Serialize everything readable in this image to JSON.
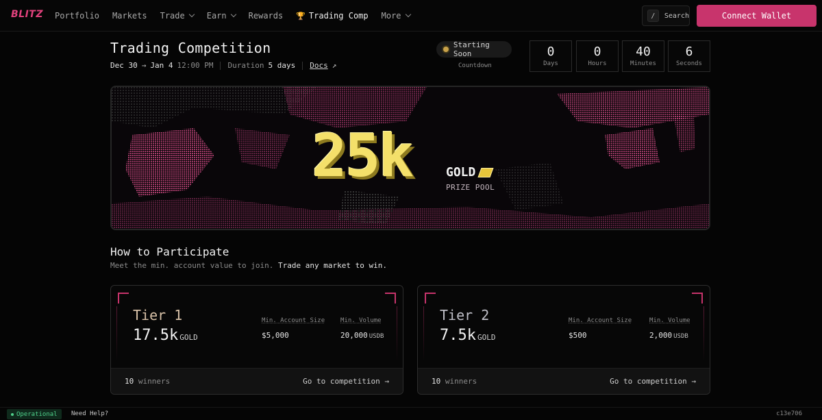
{
  "brand": "BLITZ",
  "nav": {
    "portfolio": "Portfolio",
    "markets": "Markets",
    "trade": "Trade",
    "earn": "Earn",
    "rewards": "Rewards",
    "trading_comp": "Trading Comp",
    "more": "More"
  },
  "search": {
    "key": "/",
    "label": "Search"
  },
  "connect_wallet": "Connect Wallet",
  "header": {
    "title": "Trading Competition",
    "start": "Dec 30",
    "end": "Jan 4",
    "time": "12:00 PM",
    "duration_label": "Duration",
    "duration_value": "5 days",
    "docs": "Docs"
  },
  "status": "Starting Soon",
  "countdown_label": "Countdown",
  "countdown": [
    {
      "value": "0",
      "unit": "Days"
    },
    {
      "value": "0",
      "unit": "Hours"
    },
    {
      "value": "40",
      "unit": "Minutes"
    },
    {
      "value": "6",
      "unit": "Seconds"
    }
  ],
  "banner": {
    "amount": "25k",
    "token": "GOLD",
    "caption": "PRIZE POOL"
  },
  "how": {
    "title": "How to Participate",
    "sub_muted": "Meet the min. account value to join.",
    "sub_bright": "Trade any market to win."
  },
  "tiers": [
    {
      "name": "Tier 1",
      "amount": "17.5k",
      "token": "GOLD",
      "min_account_label": "Min. Account Size",
      "min_account_value": "$5,000",
      "min_volume_label": "Min. Volume",
      "min_volume_value": "20,000",
      "min_volume_unit": "USDB",
      "winners_count": "10",
      "winners_label": "winners",
      "cta": "Go to competition →"
    },
    {
      "name": "Tier 2",
      "amount": "7.5k",
      "token": "GOLD",
      "min_account_label": "Min. Account Size",
      "min_account_value": "$500",
      "min_volume_label": "Min. Volume",
      "min_volume_value": "2,000",
      "min_volume_unit": "USDB",
      "winners_count": "10",
      "winners_label": "winners",
      "cta": "Go to competition →"
    }
  ],
  "footer": {
    "status": "Operational",
    "help": "Need Help?",
    "version": "c13e706"
  },
  "colors": {
    "accent": "#c8346c",
    "gold": "#f4e06a",
    "status_dot": "#c9a24a",
    "operational": "#4fd18b"
  }
}
